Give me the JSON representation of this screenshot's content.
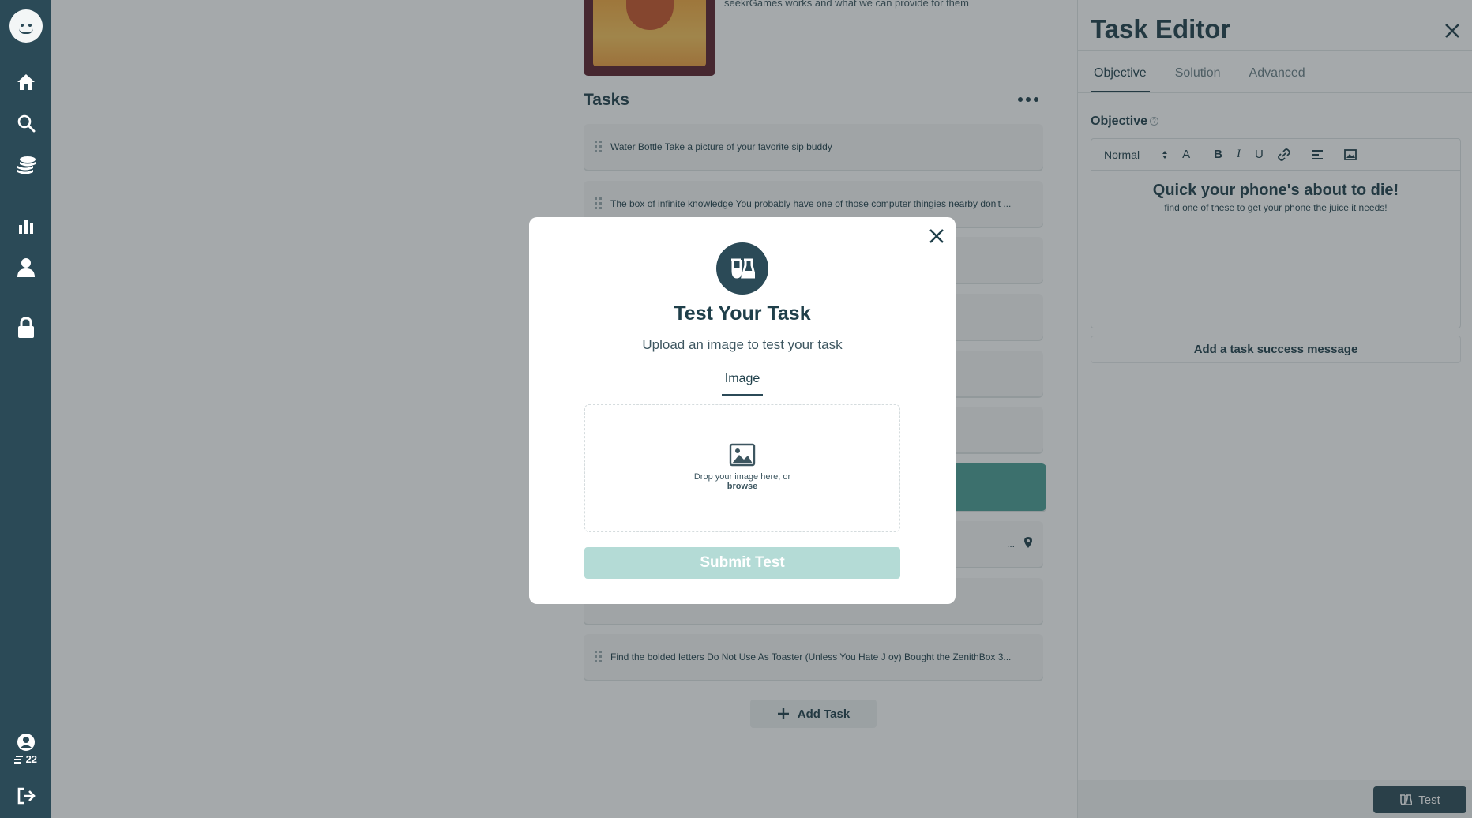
{
  "sidebar": {
    "credits": "22"
  },
  "main": {
    "cover_caption": "seekrGames works and what we can provide for them",
    "tasks_title": "Tasks",
    "tasks": [
      "Water Bottle Take a picture of your favorite sip buddy",
      "The box of infinite knowledge You probably have one of those computer thingies nearby don't ...",
      "",
      "",
      "",
      "",
      "",
      "...",
      "",
      "Find the bolded letters Do Not Use As Toaster (Unless You Hate J oy) Bought the ZenithBox 3..."
    ],
    "add_task_label": "Add Task"
  },
  "panel": {
    "title": "Task Editor",
    "tabs": [
      "Objective",
      "Solution",
      "Advanced"
    ],
    "objective_label": "Objective",
    "format_select": "Normal",
    "editor_heading": "Quick your phone's about to die!",
    "editor_text": "find one of these to get your phone the juice it needs!",
    "success_message_label": "Add a task success message",
    "test_label": "Test"
  },
  "modal": {
    "title": "Test Your Task",
    "subtitle": "Upload an image to test your task",
    "tab_label": "Image",
    "drop_text": "Drop your image here, or",
    "browse_text": "browse",
    "submit_label": "Submit Test"
  }
}
